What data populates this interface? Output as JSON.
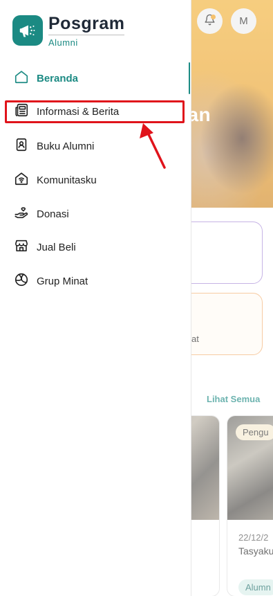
{
  "brand": {
    "name": "Posgram",
    "subtitle": "Alumni",
    "accent": "#1b8a83"
  },
  "menu": {
    "items": [
      {
        "label": "Beranda",
        "icon": "home-icon",
        "active": true
      },
      {
        "label": "Informasi & Berita",
        "icon": "newspaper-icon",
        "active": false
      },
      {
        "label": "Buku Alumni",
        "icon": "contact-book-icon",
        "active": false
      },
      {
        "label": "Komunitasku",
        "icon": "community-home-icon",
        "active": false
      },
      {
        "label": "Donasi",
        "icon": "donation-hand-icon",
        "active": false
      },
      {
        "label": "Jual Beli",
        "icon": "store-icon",
        "active": false
      },
      {
        "label": "Grup Minat",
        "icon": "volleyball-icon",
        "active": false
      }
    ]
  },
  "background": {
    "hero_text": "aman",
    "avatar_initial": "M",
    "card_fragment": "at",
    "see_all": "Lihat Semua",
    "news": {
      "tag": "Pengu",
      "date": "22/12/2",
      "title": "Tasyaku Malang",
      "chip": "Alumn"
    }
  },
  "annotation": {
    "color": "#e0131b"
  }
}
